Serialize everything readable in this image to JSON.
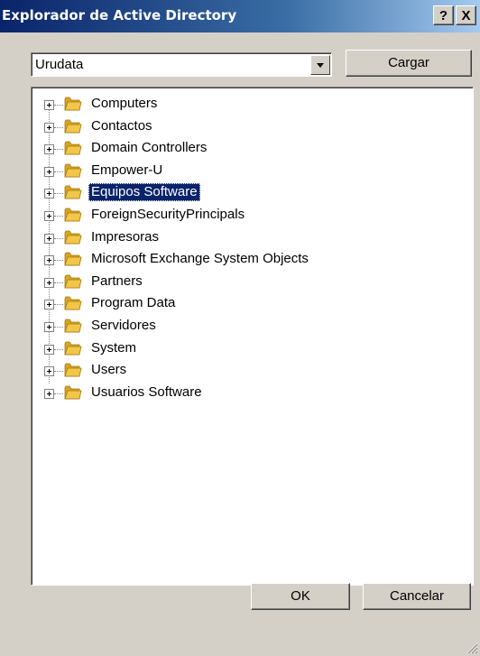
{
  "window": {
    "title": "Explorador de Active Directory",
    "help_label": "?",
    "close_label": "X"
  },
  "domain_combo": {
    "value": "Urudata",
    "load_label": "Cargar"
  },
  "tree": {
    "items": [
      {
        "label": "Computers",
        "selected": false
      },
      {
        "label": "Contactos",
        "selected": false
      },
      {
        "label": "Domain Controllers",
        "selected": false
      },
      {
        "label": "Empower-U",
        "selected": false
      },
      {
        "label": "Equipos Software",
        "selected": true
      },
      {
        "label": "ForeignSecurityPrincipals",
        "selected": false
      },
      {
        "label": "Impresoras",
        "selected": false
      },
      {
        "label": "Microsoft Exchange System Objects",
        "selected": false
      },
      {
        "label": "Partners",
        "selected": false
      },
      {
        "label": "Program Data",
        "selected": false
      },
      {
        "label": "Servidores",
        "selected": false
      },
      {
        "label": "System",
        "selected": false
      },
      {
        "label": "Users",
        "selected": false
      },
      {
        "label": "Usuarios Software",
        "selected": false
      }
    ]
  },
  "footer": {
    "ok_label": "OK",
    "cancel_label": "Cancelar"
  },
  "colors": {
    "title_bar": "#0a246a",
    "selection": "#0a246a",
    "folder": "#f2c649"
  }
}
